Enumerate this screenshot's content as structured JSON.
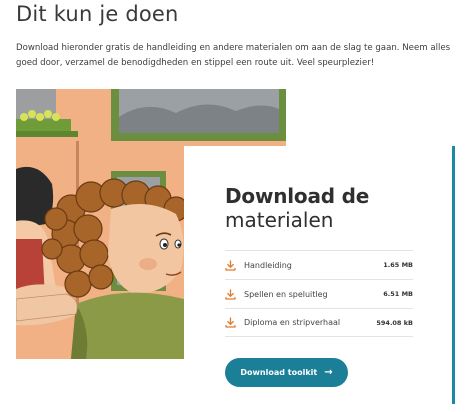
{
  "section": {
    "title": "Dit kun je doen",
    "intro": "Download hieronder gratis de handleiding en andere materialen om aan de slag te gaan. Neem alles goed door, verzamel de benodigdheden en stippel een route uit. Veel speurplezier!"
  },
  "card": {
    "title_bold": "Download de",
    "title_light": "materialen",
    "downloads": [
      {
        "label": "Handleiding",
        "size": "1.65 MB",
        "icon": "download-icon"
      },
      {
        "label": "Spellen en speluitleg",
        "size": "6.51 MB",
        "icon": "download-icon"
      },
      {
        "label": "Diploma en stripverhaal",
        "size": "594.08 kB",
        "icon": "download-icon"
      }
    ],
    "button_label": "Download toolkit",
    "button_icon": "arrow-right-icon"
  },
  "colors": {
    "accent": "#1a7f97",
    "icon_orange": "#e07a2e",
    "accent_bar": "#1a8aa0"
  }
}
